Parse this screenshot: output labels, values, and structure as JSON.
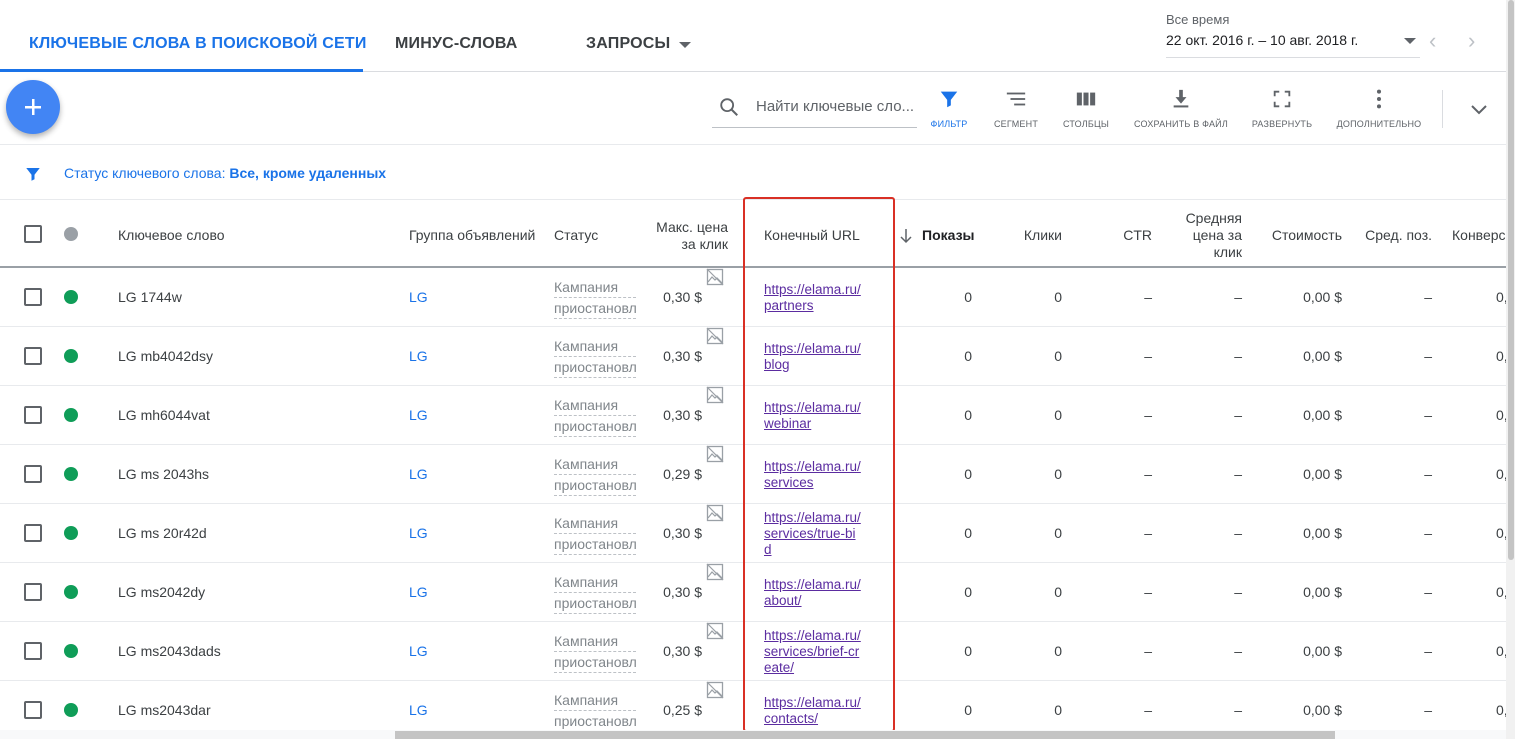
{
  "tabs": [
    {
      "label": "КЛЮЧЕВЫЕ СЛОВА В ПОИСКОВОЙ СЕТИ"
    },
    {
      "label": "МИНУС-СЛОВА"
    },
    {
      "label": "ЗАПРОСЫ"
    }
  ],
  "date": {
    "label": "Все время",
    "range": "22 окт. 2016 г. – 10 авг. 2018 г."
  },
  "toolbar": {
    "search_placeholder": "Найти ключевые сло...",
    "tools": [
      {
        "label": "ФИЛЬТР",
        "icon": "filter-icon"
      },
      {
        "label": "СЕГМЕНТ",
        "icon": "segment-icon"
      },
      {
        "label": "СТОЛБЦЫ",
        "icon": "columns-icon"
      },
      {
        "label": "СОХРАНИТЬ В ФАЙЛ",
        "icon": "download-icon"
      },
      {
        "label": "РАЗВЕРНУТЬ",
        "icon": "fullscreen-icon"
      },
      {
        "label": "ДОПОЛНИТЕЛЬНО",
        "icon": "more-vert-icon"
      }
    ]
  },
  "filter": {
    "label": "Статус ключевого слова: ",
    "value": "Все, кроме удаленных"
  },
  "columns": {
    "keyword": "Ключевое слово",
    "adgroup": "Группа объявлений",
    "status": "Статус",
    "maxcpc_1": "Макс. цена",
    "maxcpc_2": "за клик",
    "final_url": "Конечный URL",
    "impressions": "Показы",
    "clicks": "Клики",
    "ctr": "CTR",
    "avgcpc_1": "Средняя",
    "avgcpc_2": "цена за",
    "avgcpc_3": "клик",
    "cost": "Стоимость",
    "avgpos": "Сред. поз.",
    "conv": "Конверс"
  },
  "colors": {
    "accent": "#1a73e8",
    "status_enabled": "#0f9d58",
    "highlight": "#d93025"
  },
  "rows": [
    {
      "keyword": "LG 1744w",
      "adgroup": "LG",
      "status_1": "Кампания",
      "status_2": "приостановл",
      "maxcpc": "0,30 $",
      "url": "https://elama.ru/partners",
      "impressions": "0",
      "clicks": "0",
      "ctr": "–",
      "avgcpc": "–",
      "cost": "0,00 $",
      "avgpos": "–",
      "conv": "0,"
    },
    {
      "keyword": "LG mb4042dsy",
      "adgroup": "LG",
      "status_1": "Кампания",
      "status_2": "приостановл",
      "maxcpc": "0,30 $",
      "url": "https://elama.ru/blog",
      "impressions": "0",
      "clicks": "0",
      "ctr": "–",
      "avgcpc": "–",
      "cost": "0,00 $",
      "avgpos": "–",
      "conv": "0,"
    },
    {
      "keyword": "LG mh6044vat",
      "adgroup": "LG",
      "status_1": "Кампания",
      "status_2": "приостановл",
      "maxcpc": "0,30 $",
      "url": "https://elama.ru/webinar",
      "impressions": "0",
      "clicks": "0",
      "ctr": "–",
      "avgcpc": "–",
      "cost": "0,00 $",
      "avgpos": "–",
      "conv": "0,"
    },
    {
      "keyword": "LG ms 2043hs",
      "adgroup": "LG",
      "status_1": "Кампания",
      "status_2": "приостановл",
      "maxcpc": "0,29 $",
      "url": "https://elama.ru/services",
      "impressions": "0",
      "clicks": "0",
      "ctr": "–",
      "avgcpc": "–",
      "cost": "0,00 $",
      "avgpos": "–",
      "conv": "0,"
    },
    {
      "keyword": "LG ms 20r42d",
      "adgroup": "LG",
      "status_1": "Кампания",
      "status_2": "приостановл",
      "maxcpc": "0,30 $",
      "url": "https://elama.ru/services/true-bid",
      "impressions": "0",
      "clicks": "0",
      "ctr": "–",
      "avgcpc": "–",
      "cost": "0,00 $",
      "avgpos": "–",
      "conv": "0,"
    },
    {
      "keyword": "LG ms2042dy",
      "adgroup": "LG",
      "status_1": "Кампания",
      "status_2": "приостановл",
      "maxcpc": "0,30 $",
      "url": "https://elama.ru/about/",
      "impressions": "0",
      "clicks": "0",
      "ctr": "–",
      "avgcpc": "–",
      "cost": "0,00 $",
      "avgpos": "–",
      "conv": "0,"
    },
    {
      "keyword": "LG ms2043dads",
      "adgroup": "LG",
      "status_1": "Кампания",
      "status_2": "приостановл",
      "maxcpc": "0,30 $",
      "url": "https://elama.ru/services/brief-create/",
      "impressions": "0",
      "clicks": "0",
      "ctr": "–",
      "avgcpc": "–",
      "cost": "0,00 $",
      "avgpos": "–",
      "conv": "0,"
    },
    {
      "keyword": "LG ms2043dar",
      "adgroup": "LG",
      "status_1": "Кампания",
      "status_2": "приостановл",
      "maxcpc": "0,25 $",
      "url": "https://elama.ru/contacts/",
      "impressions": "0",
      "clicks": "0",
      "ctr": "–",
      "avgcpc": "–",
      "cost": "0,00 $",
      "avgpos": "–",
      "conv": "0,"
    }
  ]
}
